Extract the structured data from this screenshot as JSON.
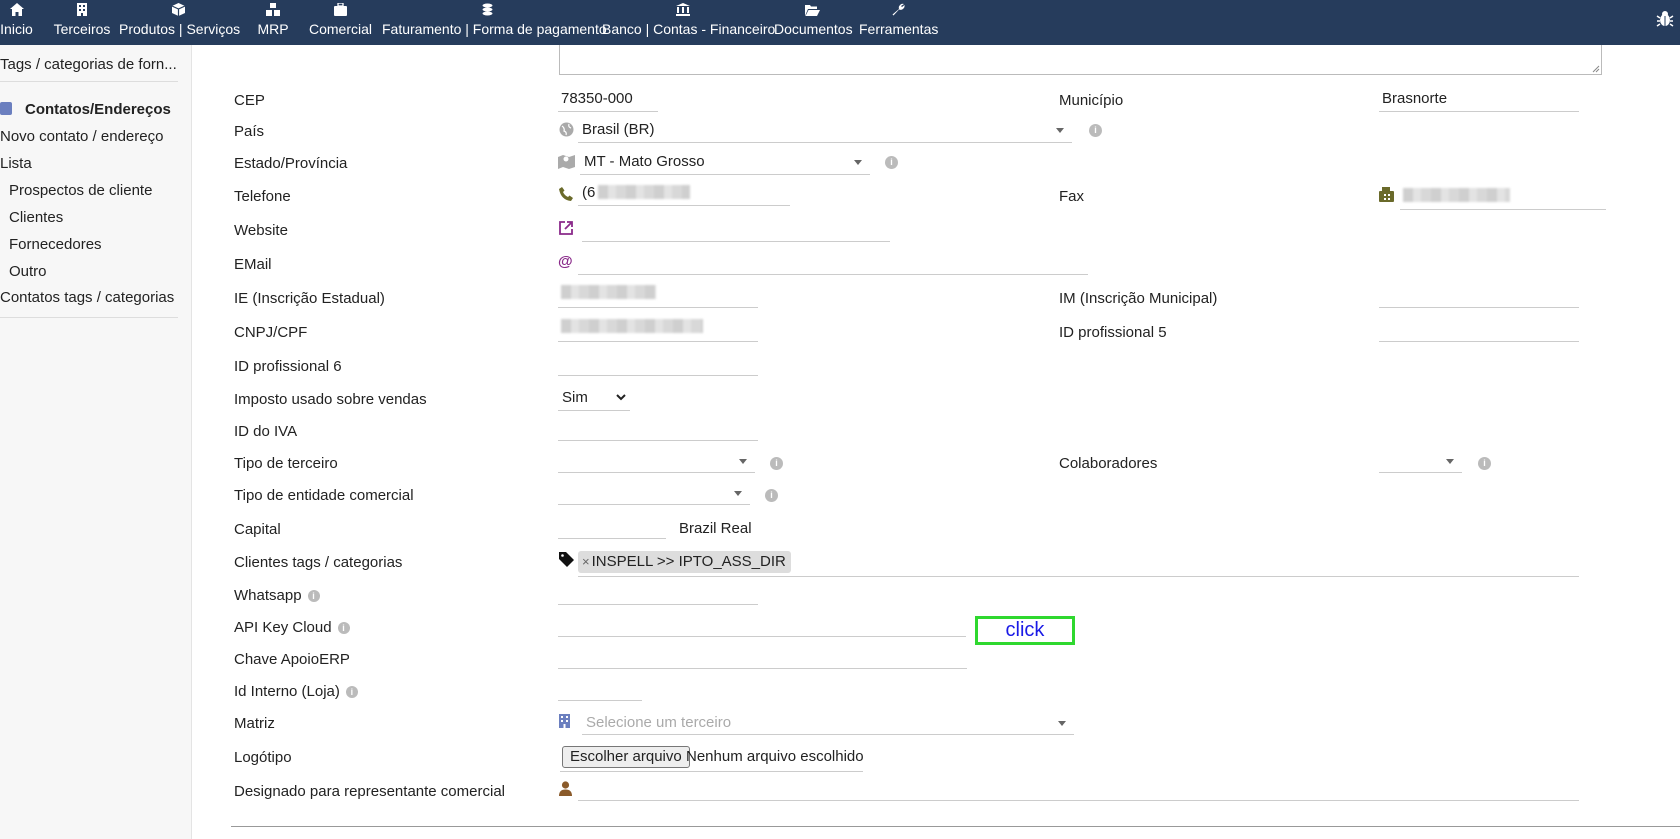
{
  "topbar": {
    "items": [
      {
        "label": "Inicio",
        "icon": "home-icon"
      },
      {
        "label": "Terceiros",
        "icon": "building-icon"
      },
      {
        "label": "Produtos | Serviços",
        "icon": "cube-icon"
      },
      {
        "label": "MRP",
        "icon": "cubes-icon"
      },
      {
        "label": "Comercial",
        "icon": "suitcase-icon"
      },
      {
        "label": "Faturamento | Forma de pagamento",
        "icon": "coins-icon"
      },
      {
        "label": "Banco | Contas - Financeiro",
        "icon": "bank-icon"
      },
      {
        "label": "Documentos",
        "icon": "folder-open-icon"
      },
      {
        "label": "Ferramentas",
        "icon": "wrench-icon"
      }
    ],
    "active": "Terceiros",
    "background": "#263c5c"
  },
  "sidebar": {
    "tags_item": "Tags / categorias de forn...",
    "section_title": "Contatos/Endereços",
    "new_contact": "Novo contato / endereço",
    "list": "Lista",
    "sub_items": [
      "Prospectos de cliente",
      "Clientes",
      "Fornecedores",
      "Outro"
    ],
    "contacts_tags": "Contatos tags / categorias"
  },
  "form": {
    "cep": {
      "label": "CEP",
      "value": "78350-000"
    },
    "municipio": {
      "label": "Município",
      "value": "Brasnorte"
    },
    "pais": {
      "label": "País",
      "value": "Brasil (BR)"
    },
    "estado": {
      "label": "Estado/Província",
      "value": "MT - Mato Grosso"
    },
    "telefone": {
      "label": "Telefone",
      "value": "(6"
    },
    "fax": {
      "label": "Fax"
    },
    "website": {
      "label": "Website"
    },
    "email": {
      "label": "EMail"
    },
    "ie": {
      "label": "IE (Inscrição Estadual)"
    },
    "im": {
      "label": "IM (Inscrição Municipal)"
    },
    "cnpj": {
      "label": "CNPJ/CPF"
    },
    "id_prof5": {
      "label": "ID profissional 5"
    },
    "id_prof6": {
      "label": "ID profissional 6"
    },
    "imposto": {
      "label": "Imposto usado sobre vendas",
      "value": "Sim"
    },
    "iva": {
      "label": "ID do IVA"
    },
    "tipo_terceiro": {
      "label": "Tipo de terceiro"
    },
    "colaboradores": {
      "label": "Colaboradores"
    },
    "tipo_entidade": {
      "label": "Tipo de entidade comercial"
    },
    "capital": {
      "label": "Capital",
      "currency": "Brazil Real"
    },
    "clientes_tags": {
      "label": "Clientes tags / categorias",
      "tag": "INSPELL >> IPTO_ASS_DIR"
    },
    "whatsapp": {
      "label": "Whatsapp"
    },
    "api_key": {
      "label": "API Key Cloud",
      "button": "click"
    },
    "chave": {
      "label": "Chave ApoioERP"
    },
    "id_interno": {
      "label": "Id Interno (Loja)"
    },
    "matriz": {
      "label": "Matriz",
      "placeholder": "Selecione um terceiro"
    },
    "logotipo": {
      "label": "Logótipo",
      "button": "Escolher arquivo",
      "status": "Nenhum arquivo escolhido"
    },
    "representante": {
      "label": "Designado para representante comercial"
    }
  }
}
